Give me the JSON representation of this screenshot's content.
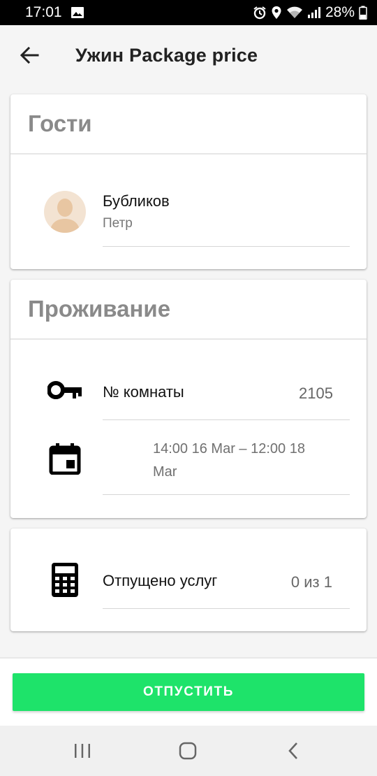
{
  "status_bar": {
    "time": "17:01",
    "battery": "28%"
  },
  "app_bar": {
    "title": "Ужин Package price"
  },
  "guests": {
    "header": "Гости",
    "guest": {
      "last_name": "Бубликов",
      "first_name": "Петр"
    }
  },
  "stay": {
    "header": "Проживание",
    "room_label": "№ комнаты",
    "room_number": "2105",
    "dates": "14:00 16 Mar – 12:00 18 Mar"
  },
  "services": {
    "label": "Отпущено услуг",
    "value": "0 из 1"
  },
  "action": {
    "release_label": "ОТПУСТИТЬ"
  },
  "colors": {
    "accent": "#1ee36a",
    "header_text": "#8a8a8a"
  },
  "icons": [
    "back-arrow-icon",
    "key-icon",
    "calendar-icon",
    "calculator-icon",
    "avatar-icon",
    "recent-apps-icon",
    "home-icon",
    "nav-back-icon"
  ]
}
